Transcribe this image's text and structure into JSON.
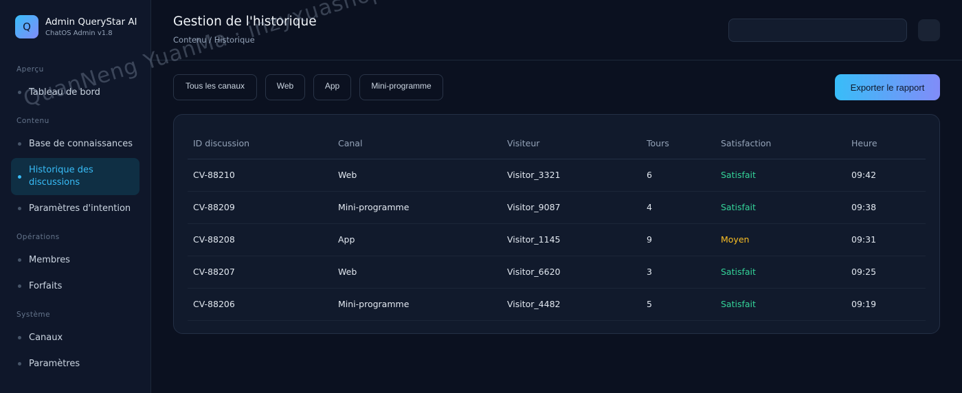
{
  "brand": {
    "logo_letter": "Q",
    "title": "Admin QueryStar AI",
    "subtitle": "ChatOS Admin v1.8"
  },
  "sidebar": {
    "sections": [
      {
        "label": "Aperçu",
        "items": [
          {
            "label": "Tableau de bord",
            "active": false
          }
        ]
      },
      {
        "label": "Contenu",
        "items": [
          {
            "label": "Base de connaissances",
            "active": false
          },
          {
            "label": "Historique des discussions",
            "active": true
          },
          {
            "label": "Paramètres d'intention",
            "active": false
          }
        ]
      },
      {
        "label": "Opérations",
        "items": [
          {
            "label": "Membres",
            "active": false
          },
          {
            "label": "Forfaits",
            "active": false
          }
        ]
      },
      {
        "label": "Système",
        "items": [
          {
            "label": "Canaux",
            "active": false
          },
          {
            "label": "Paramètres",
            "active": false
          }
        ]
      }
    ]
  },
  "header": {
    "title": "Gestion de l'historique",
    "breadcrumb": "Contenu / Historique",
    "search": {
      "value": "",
      "placeholder": ""
    }
  },
  "filters": [
    "Tous les canaux",
    "Web",
    "App",
    "Mini-programme"
  ],
  "export_label": "Exporter le rapport",
  "table": {
    "columns": [
      "ID discussion",
      "Canal",
      "Visiteur",
      "Tours",
      "Satisfaction",
      "Heure"
    ],
    "rows": [
      [
        "CV-88210",
        "Web",
        "Visitor_3321",
        "6",
        "Satisfait",
        "09:42"
      ],
      [
        "CV-88209",
        "Mini-programme",
        "Visitor_9087",
        "4",
        "Satisfait",
        "09:38"
      ],
      [
        "CV-88208",
        "App",
        "Visitor_1145",
        "9",
        "Moyen",
        "09:31"
      ],
      [
        "CV-88207",
        "Web",
        "Visitor_6620",
        "3",
        "Satisfait",
        "09:25"
      ],
      [
        "CV-88206",
        "Mini-programme",
        "Visitor_4482",
        "5",
        "Satisfait",
        "09:19"
      ]
    ]
  },
  "watermark": "QuanNeng YuanMa · inzyxuashop.com",
  "colors": {
    "accent": "#38bdf8",
    "accent_end": "#818cf8",
    "satisfied": "#34d399",
    "average": "#fbbf24",
    "background": "#0b1120"
  }
}
